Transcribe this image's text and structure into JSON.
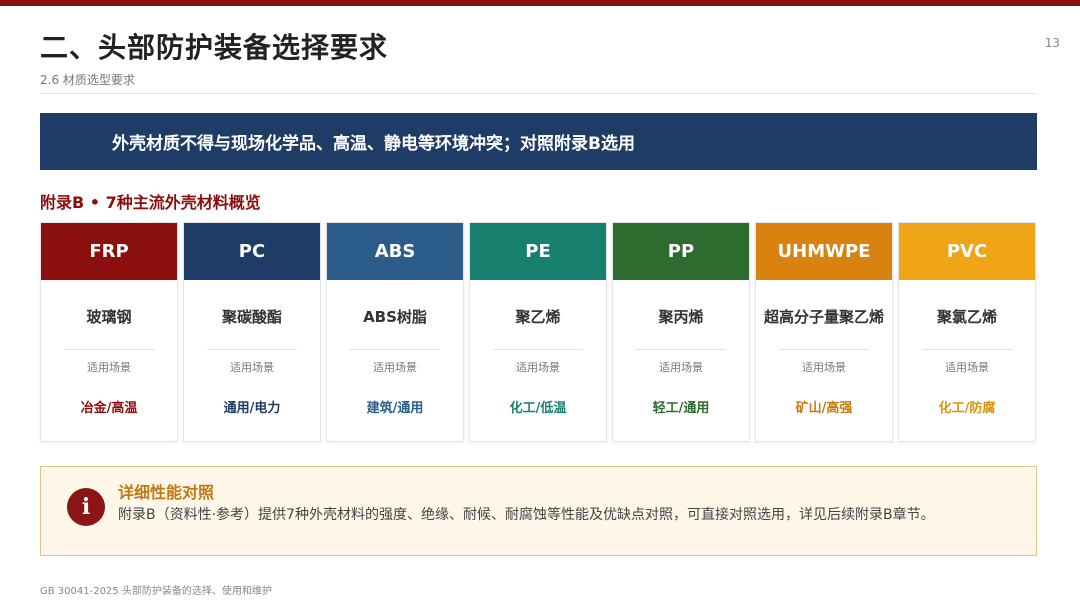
{
  "header": {
    "title": "二、头部防护装备选择要求",
    "subtitle": "2.6 材质选型要求",
    "page_number": "13"
  },
  "banner": {
    "text": "外壳材质不得与现场化学品、高温、静电等环境冲突；对照附录B选用"
  },
  "section": {
    "heading": "附录B • 7种主流外壳材料概览"
  },
  "materials": [
    {
      "code": "FRP",
      "name": "玻璃钢",
      "label": "适用场景",
      "use": "冶金/高温",
      "head_color": "#8b0f0f",
      "use_color": "#8b0f0f"
    },
    {
      "code": "PC",
      "name": "聚碳酸酯",
      "label": "适用场景",
      "use": "通用/电力",
      "head_color": "#1f3c66",
      "use_color": "#1f3c66"
    },
    {
      "code": "ABS",
      "name": "ABS树脂",
      "label": "适用场景",
      "use": "建筑/通用",
      "head_color": "#2b5c8a",
      "use_color": "#2b5c8a"
    },
    {
      "code": "PE",
      "name": "聚乙烯",
      "label": "适用场景",
      "use": "化工/低温",
      "head_color": "#17806e",
      "use_color": "#17806e"
    },
    {
      "code": "PP",
      "name": "聚丙烯",
      "label": "适用场景",
      "use": "轻工/通用",
      "head_color": "#2e6b2e",
      "use_color": "#2e6b2e"
    },
    {
      "code": "UHMWPE",
      "name": "超高分子量聚乙烯",
      "label": "适用场景",
      "use": "矿山/高强",
      "head_color": "#d9820f",
      "use_color": "#c9780c"
    },
    {
      "code": "PVC",
      "name": "聚氯乙烯",
      "label": "适用场景",
      "use": "化工/防腐",
      "head_color": "#f0a516",
      "use_color": "#d9920a"
    }
  ],
  "note": {
    "icon": "info-icon",
    "icon_glyph": "i",
    "title": "详细性能对照",
    "text": "附录B（资料性·参考）提供7种外壳材料的强度、绝缘、耐候、耐腐蚀等性能及优缺点对照，可直接对照选用，详见后续附录B章节。"
  },
  "footer": {
    "text": "GB 30041-2025 头部防护装备的选择、使用和维护"
  }
}
